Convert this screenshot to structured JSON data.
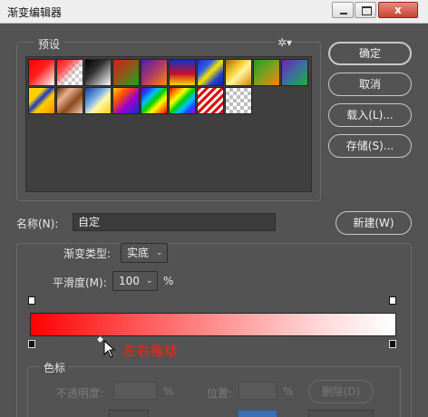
{
  "window": {
    "title": "渐变编辑器",
    "close_symbol": "x"
  },
  "presets": {
    "label": "预设",
    "gear_symbol": "✲▾",
    "swatch_icons": [
      "red-transparent",
      "red-checker",
      "black-white",
      "red-green",
      "purple-orange",
      "blue-red-yellow",
      "blue-yellow-blue",
      "gold-metallic",
      "green-orange",
      "violet-green",
      "gold-blue-stripe",
      "copper",
      "steel-blue-yellow",
      "yellow-violet-orange-blue",
      "spectrum-violet",
      "spectrum-rainbow",
      "red-white-stripes",
      "transparent-checker"
    ]
  },
  "buttons": {
    "ok": "确定",
    "cancel": "取消",
    "load": "载入(L)...",
    "save": "存储(S)...",
    "new": "新建(W)",
    "delete": "删除(D)"
  },
  "name": {
    "label": "名称(N):",
    "value": "自定"
  },
  "gradient": {
    "type_label": "渐变类型:",
    "type_value": "实底",
    "smooth_label": "平滑度(M):",
    "smooth_value": "100",
    "smooth_unit": "%"
  },
  "colorstops": {
    "group_label": "色标",
    "opacity_label": "不透明度:",
    "opacity_unit": "%",
    "location_label": "位置:",
    "location_unit": "%"
  },
  "annotation": "左右拖动",
  "colors": {
    "accent_red": "#e0281b",
    "gradient_start": "#ff0000",
    "gradient_end": "#ffffff"
  }
}
